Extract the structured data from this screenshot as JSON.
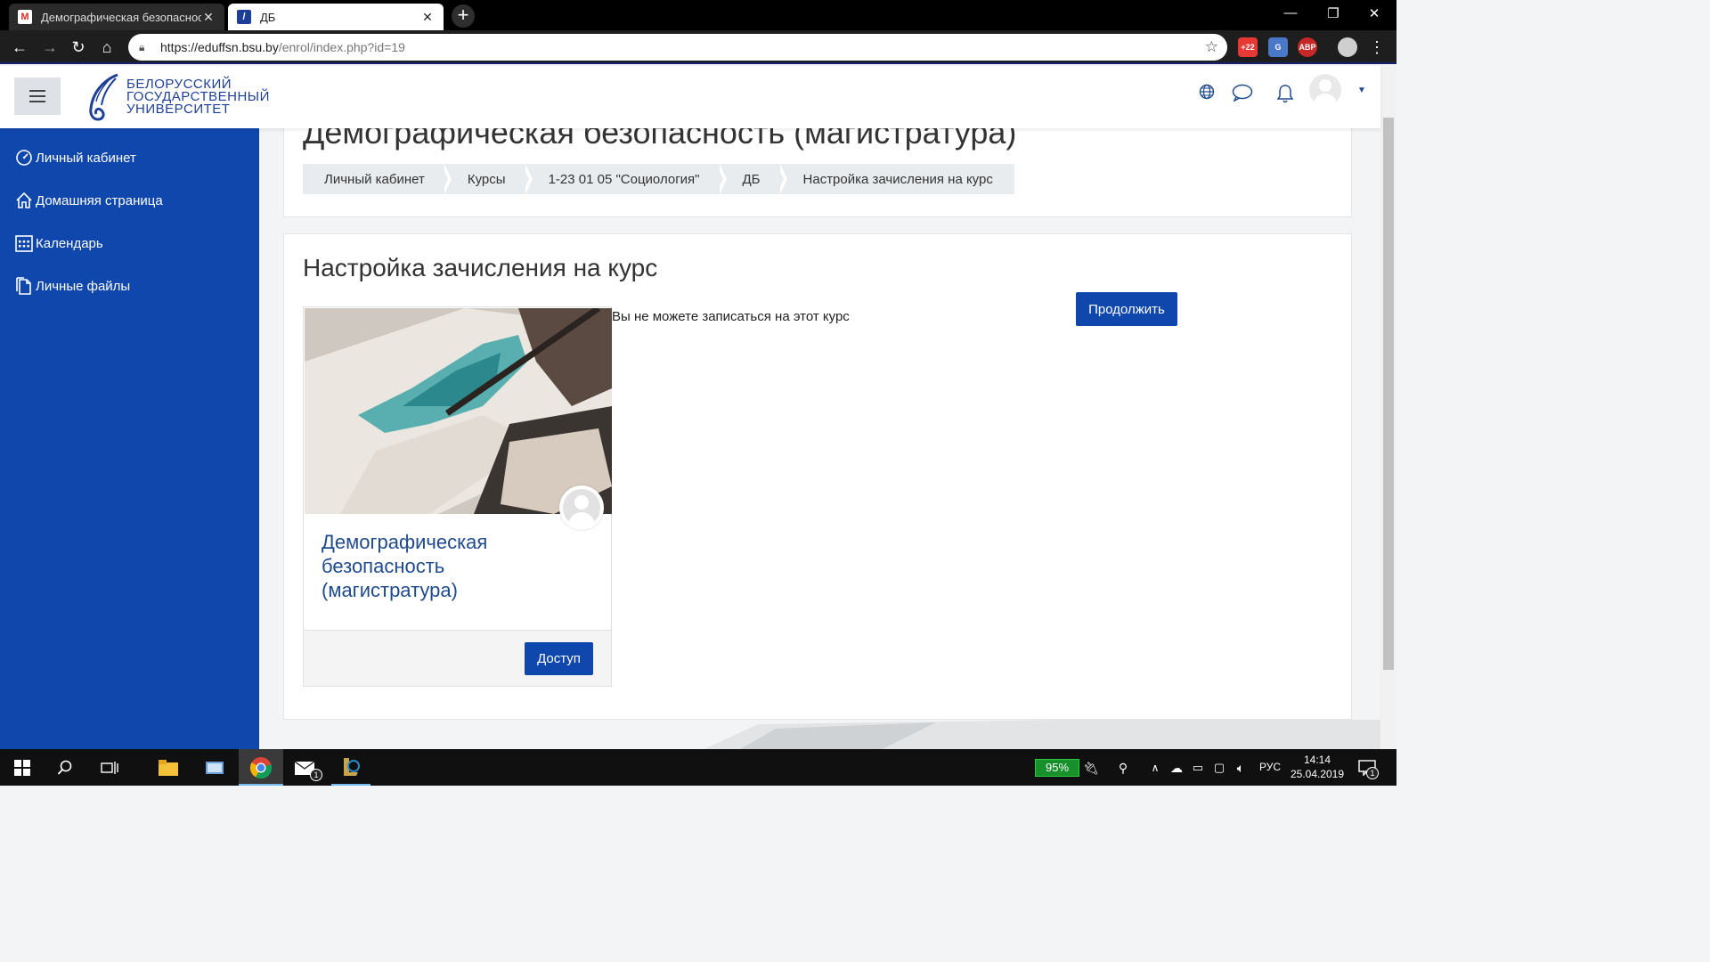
{
  "browser": {
    "tabs": [
      {
        "title": "Демографическая безопасность",
        "active": false,
        "favicon": "gmail-icon"
      },
      {
        "title": "ДБ",
        "active": true,
        "favicon": "moodle-icon"
      }
    ],
    "url_host": "https://eduffsn.bsu.by",
    "url_path": "/enrol/index.php?id=19",
    "extensions": [
      {
        "name": "weather-extension-icon",
        "badge": "+22"
      },
      {
        "name": "translate-extension-icon",
        "badge": "G"
      },
      {
        "name": "adblock-extension-icon",
        "badge": "ABP"
      }
    ]
  },
  "header": {
    "logo_lines": [
      "БЕЛОРУССКИЙ",
      "ГОСУДАРСТВЕННЫЙ",
      "УНИВЕРСИТЕТ"
    ]
  },
  "sidebar": {
    "items": [
      {
        "label": "Личный кабинет",
        "icon": "dashboard-icon"
      },
      {
        "label": "Домашняя страница",
        "icon": "home-icon"
      },
      {
        "label": "Календарь",
        "icon": "calendar-icon"
      },
      {
        "label": "Личные файлы",
        "icon": "files-icon"
      }
    ]
  },
  "main": {
    "course_title": "Демографическая безопасность (магистратура)",
    "breadcrumb": [
      "Личный кабинет",
      "Курсы",
      "1-23 01 05 \"Социология\"",
      "ДБ",
      "Настройка зачисления на курс"
    ],
    "page_heading": "Настройка зачисления на курс",
    "course_card": {
      "name": "Демографическая безопасность (магистратура)",
      "access_button": "Доступ"
    },
    "notice": "Вы не можете записаться на этот курс",
    "continue_button": "Продолжить"
  },
  "taskbar": {
    "battery": "95%",
    "lang": "РУС",
    "time": "14:14",
    "date": "25.04.2019",
    "mail_badge": "1",
    "notification_badge": "1"
  },
  "colors": {
    "sidebar": "#0f47ad",
    "primary_button": "#0f47ad",
    "link": "#1f4b8e"
  }
}
